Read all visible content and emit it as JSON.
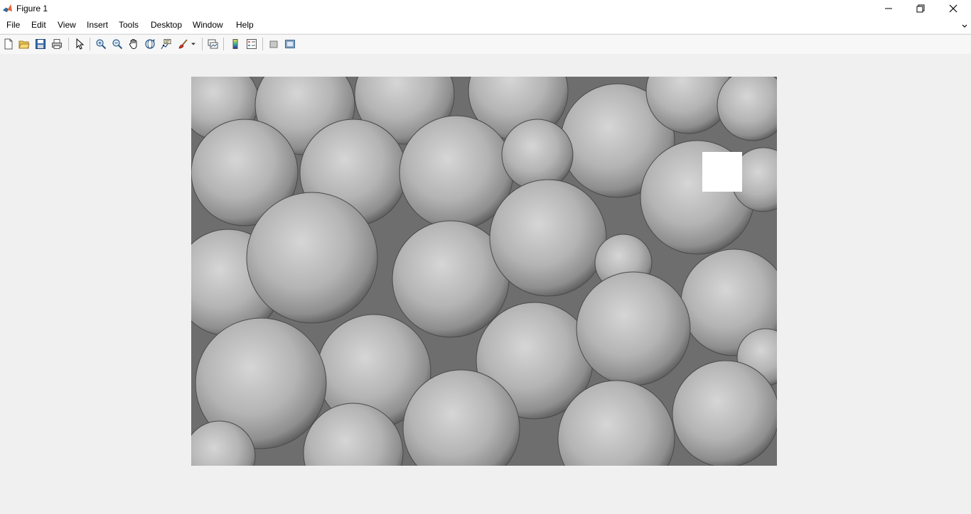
{
  "window": {
    "title": "Figure 1"
  },
  "menu": [
    "File",
    "Edit",
    "View",
    "Insert",
    "Tools",
    "Desktop",
    "Window",
    "Help"
  ],
  "toolbar": {
    "buttons": [
      "new-figure",
      "open-file",
      "save-figure",
      "print-figure",
      "edit-plot",
      "zoom-in",
      "zoom-out",
      "pan",
      "rotate-3d",
      "data-cursor",
      "brush",
      "link-plot",
      "insert-colorbar",
      "insert-legend",
      "hide-plot-tools",
      "show-plot-tools"
    ]
  },
  "figure": {
    "image_description_colors": {
      "background": "#8c8c8c",
      "patch": "#ffffff"
    }
  }
}
